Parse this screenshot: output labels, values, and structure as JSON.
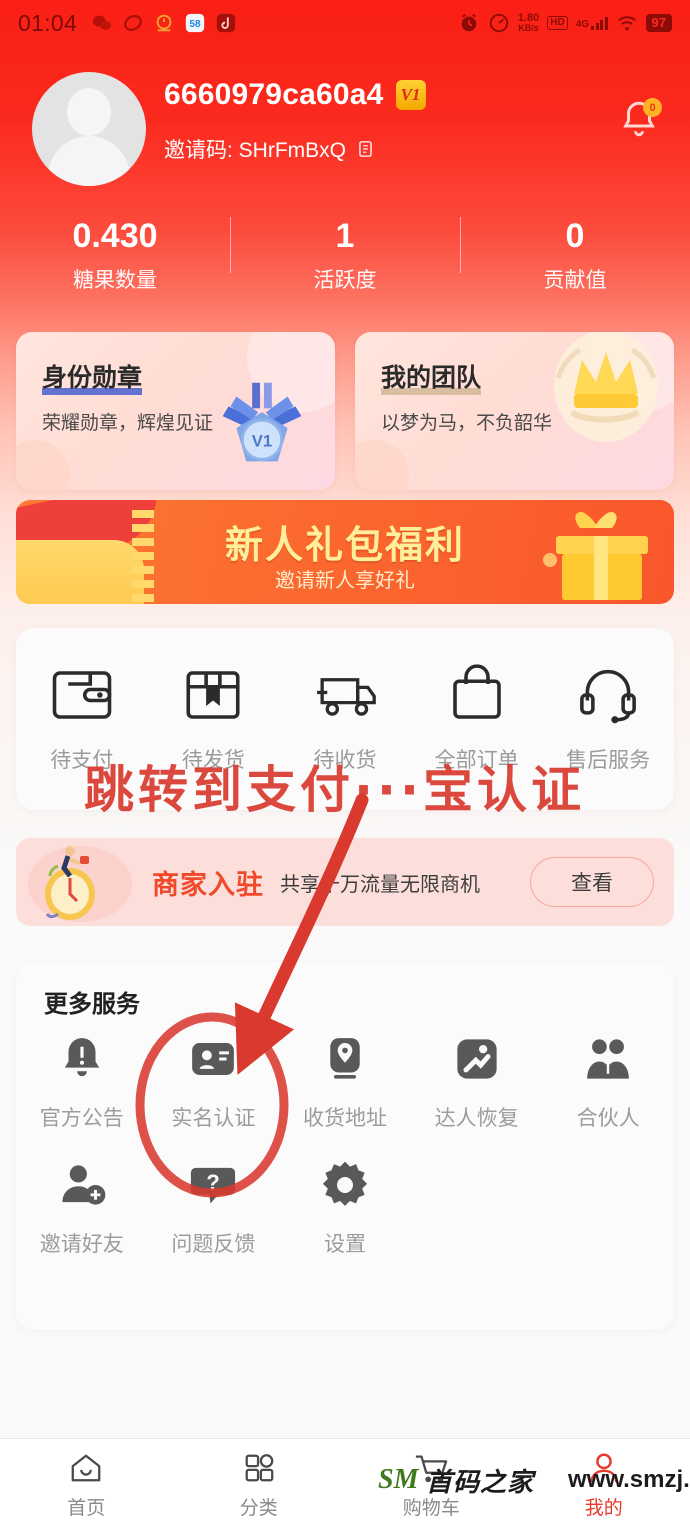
{
  "status_bar": {
    "time": "01:04",
    "left_icons": [
      "wechat-icon",
      "app-oval-icon",
      "alarm-app-icon",
      "icon-58",
      "douyin-icon"
    ],
    "net_speed_value": "1.80",
    "net_speed_unit": "KB/s",
    "hd_label": "HD",
    "network_type": "4G",
    "battery": "97",
    "right_icons": [
      "alarm-clock-icon",
      "speedometer-icon",
      "hd-icon",
      "signal-icon",
      "wifi-icon",
      "battery-icon"
    ]
  },
  "profile": {
    "username": "6660979ca60a4",
    "level_badge": "V1",
    "invite_label": "邀请码: SHrFmBxQ",
    "copy_icon": "copy-icon",
    "bell_icon": "bell-icon",
    "bell_count": "0"
  },
  "stats": [
    {
      "value": "0.430",
      "label": "糖果数量"
    },
    {
      "value": "1",
      "label": "活跃度"
    },
    {
      "value": "0",
      "label": "贡献值"
    }
  ],
  "feature_cards": [
    {
      "title": "身份勋章",
      "subtitle": "荣耀勋章，辉煌见证",
      "icon": "medal-v1-icon"
    },
    {
      "title": "我的团队",
      "subtitle": "以梦为马，不负韶华",
      "icon": "crown-icon"
    }
  ],
  "newcomer_banner": {
    "title": "新人礼包福利",
    "subtitle": "邀请新人享好礼",
    "icon": "gift-box-icon"
  },
  "order_section": {
    "items": [
      {
        "label": "待支付",
        "icon": "wallet-icon"
      },
      {
        "label": "待发货",
        "icon": "package-icon"
      },
      {
        "label": "待收货",
        "icon": "truck-icon"
      },
      {
        "label": "全部订单",
        "icon": "shopping-bag-icon"
      },
      {
        "label": "售后服务",
        "icon": "headset-icon"
      }
    ]
  },
  "merchant_banner": {
    "title": "商家入驻",
    "subtitle": "共享千万流量无限商机",
    "button": "查看",
    "icon": "running-clock-icon"
  },
  "more_services": {
    "title": "更多服务",
    "rows": [
      [
        {
          "label": "官方公告",
          "icon": "announcement-bell-icon"
        },
        {
          "label": "实名认证",
          "icon": "id-card-icon"
        },
        {
          "label": "收货地址",
          "icon": "location-pin-icon"
        },
        {
          "label": "达人恢复",
          "icon": "expert-restore-icon"
        },
        {
          "label": "合伙人",
          "icon": "partners-icon"
        }
      ],
      [
        {
          "label": "邀请好友",
          "icon": "add-friend-icon"
        },
        {
          "label": "问题反馈",
          "icon": "question-feedback-icon"
        },
        {
          "label": "设置",
          "icon": "gear-icon"
        }
      ]
    ]
  },
  "tabbar": [
    {
      "label": "首页",
      "icon": "home-icon",
      "active": false
    },
    {
      "label": "分类",
      "icon": "grid-icon",
      "active": false
    },
    {
      "label": "购物车",
      "icon": "cart-icon",
      "active": false
    },
    {
      "label": "我的",
      "icon": "user-icon",
      "active": true
    }
  ],
  "annotation": {
    "text": "跳转到支付···宝认证",
    "color": "#d9392f",
    "arrow": "arrow-pointing-to-realname",
    "circle": "circle-highlight-realname"
  },
  "watermark": {
    "logo": "SM",
    "site_cn": "首码之家",
    "site_url": "www.smzj.top"
  }
}
